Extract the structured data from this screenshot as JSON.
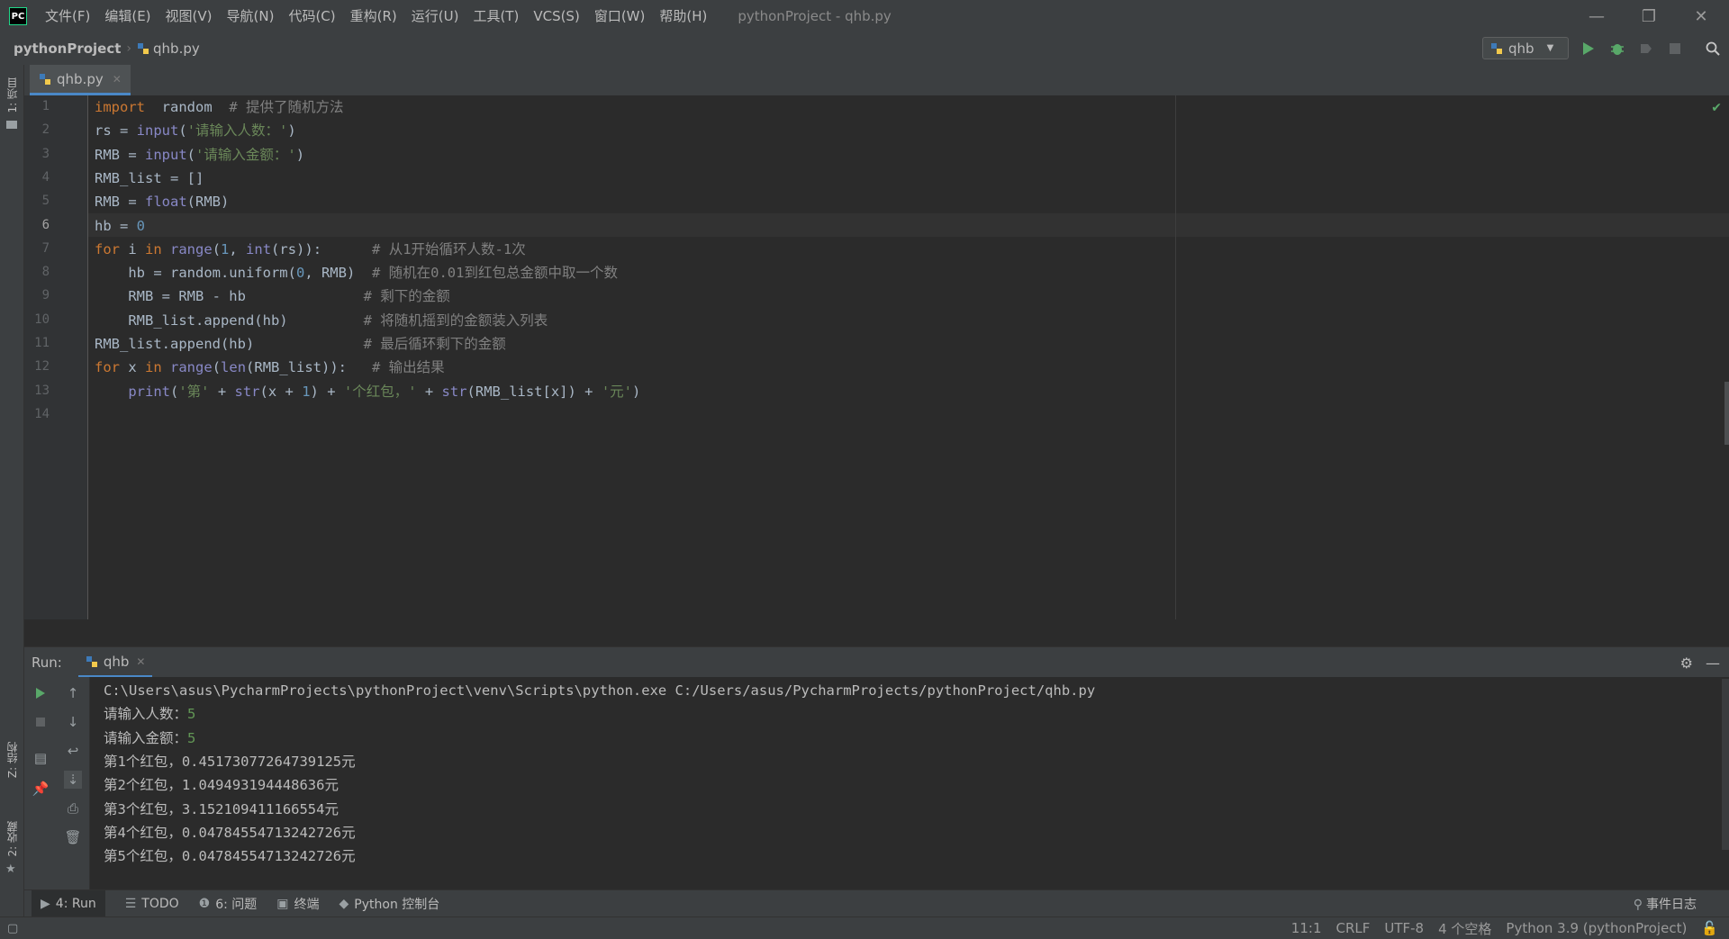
{
  "app": {
    "logo_text": "PC",
    "menu": [
      "文件(F)",
      "编辑(E)",
      "视图(V)",
      "导航(N)",
      "代码(C)",
      "重构(R)",
      "运行(U)",
      "工具(T)",
      "VCS(S)",
      "窗口(W)",
      "帮助(H)"
    ],
    "window_title": "pythonProject - qhb.py"
  },
  "navbar": {
    "project": "pythonProject",
    "file": "qhb.py",
    "run_config": "qhb"
  },
  "left_strip": {
    "project_label": "1: 项目",
    "structure_label": "Z: 结构",
    "favorites_label": "2: 收藏"
  },
  "editor": {
    "tab_label": "qhb.py",
    "current_line": 6,
    "line_numbers": [
      "1",
      "2",
      "3",
      "4",
      "5",
      "6",
      "7",
      "8",
      "9",
      "10",
      "11",
      "12",
      "13",
      "14"
    ],
    "lines": [
      {
        "seg": [
          [
            "kw",
            "import"
          ],
          [
            "",
            "  random  "
          ],
          [
            "cm",
            "# 提供了随机方法"
          ]
        ]
      },
      {
        "seg": [
          [
            "",
            "rs = "
          ],
          [
            "bi",
            "input"
          ],
          [
            "",
            "("
          ],
          [
            "str",
            "'请输入人数：'"
          ],
          [
            "",
            ")"
          ]
        ]
      },
      {
        "seg": [
          [
            "",
            "RMB = "
          ],
          [
            "bi",
            "input"
          ],
          [
            "",
            "("
          ],
          [
            "str",
            "'请输入金额：'"
          ],
          [
            "",
            ")"
          ]
        ]
      },
      {
        "seg": [
          [
            "",
            "RMB_list = []"
          ]
        ]
      },
      {
        "seg": [
          [
            "",
            "RMB = "
          ],
          [
            "bi",
            "float"
          ],
          [
            "",
            "(RMB)"
          ]
        ]
      },
      {
        "seg": [
          [
            "",
            "hb = "
          ],
          [
            "num",
            "0"
          ]
        ]
      },
      {
        "seg": [
          [
            "kw",
            "for"
          ],
          [
            "",
            " i "
          ],
          [
            "kw",
            "in"
          ],
          [
            "",
            " "
          ],
          [
            "bi",
            "range"
          ],
          [
            "",
            "("
          ],
          [
            "num",
            "1"
          ],
          [
            "",
            ", "
          ],
          [
            "bi",
            "int"
          ],
          [
            "",
            "(rs)):      "
          ],
          [
            "cm",
            "# 从1开始循环人数-1次"
          ]
        ]
      },
      {
        "seg": [
          [
            "",
            "    hb = random.uniform("
          ],
          [
            "num",
            "0"
          ],
          [
            "",
            ", RMB)  "
          ],
          [
            "cm",
            "# 随机在0.01到红包总金额中取一个数"
          ]
        ]
      },
      {
        "seg": [
          [
            "",
            "    RMB = RMB - hb              "
          ],
          [
            "cm",
            "# 剩下的金额"
          ]
        ]
      },
      {
        "seg": [
          [
            "",
            "    RMB_list.append(hb)         "
          ],
          [
            "cm",
            "# 将随机摇到的金额装入列表"
          ]
        ]
      },
      {
        "seg": [
          [
            "",
            "RMB_list.append(hb)             "
          ],
          [
            "cm",
            "# 最后循环剩下的金额"
          ]
        ]
      },
      {
        "seg": [
          [
            "kw",
            "for"
          ],
          [
            "",
            " x "
          ],
          [
            "kw",
            "in"
          ],
          [
            "",
            " "
          ],
          [
            "bi",
            "range"
          ],
          [
            "",
            "("
          ],
          [
            "bi",
            "len"
          ],
          [
            "",
            "(RMB_list)):   "
          ],
          [
            "cm",
            "# 输出结果"
          ]
        ]
      },
      {
        "seg": [
          [
            "",
            "    "
          ],
          [
            "bi",
            "print"
          ],
          [
            "",
            "("
          ],
          [
            "str",
            "'第'"
          ],
          [
            "",
            " + "
          ],
          [
            "bi",
            "str"
          ],
          [
            "",
            "(x + "
          ],
          [
            "num",
            "1"
          ],
          [
            "",
            ") + "
          ],
          [
            "str",
            "'个红包，'"
          ],
          [
            "",
            " + "
          ],
          [
            "bi",
            "str"
          ],
          [
            "",
            "(RMB_list[x]) + "
          ],
          [
            "str",
            "'元'"
          ],
          [
            "",
            ")"
          ]
        ]
      },
      {
        "seg": [
          [
            "",
            ""
          ]
        ]
      }
    ]
  },
  "run": {
    "label": "Run:",
    "tab": "qhb",
    "output": [
      {
        "text": "C:\\Users\\asus\\PycharmProjects\\pythonProject\\venv\\Scripts\\python.exe C:/Users/asus/PycharmProjects/pythonProject/qhb.py",
        "input": ""
      },
      {
        "text": "请输入人数：",
        "input": "5"
      },
      {
        "text": "请输入金额：",
        "input": "5"
      },
      {
        "text": "第1个红包，0.451730772647391​25元",
        "input": ""
      },
      {
        "text": "第2个红包，1.049493194448636元",
        "input": ""
      },
      {
        "text": "第3个红包，3.152109411166554元",
        "input": ""
      },
      {
        "text": "第4个红包，0.047845547132427​26元",
        "input": ""
      },
      {
        "text": "第5个红包，0.047845547132427​26元",
        "input": ""
      }
    ]
  },
  "bottom_tabs": [
    {
      "name": "run",
      "label": "4: Run",
      "icon": "▶"
    },
    {
      "name": "todo",
      "label": "TODO",
      "icon": "☰"
    },
    {
      "name": "problems",
      "label": "6: 问题",
      "icon": "❶"
    },
    {
      "name": "terminal",
      "label": "终端",
      "icon": "▣"
    },
    {
      "name": "python-console",
      "label": "Python 控制台",
      "icon": "◆"
    }
  ],
  "event_log": "事件日志",
  "status": {
    "position": "11:1",
    "line_sep": "CRLF",
    "encoding": "UTF-8",
    "indent": "4 个空格",
    "interpreter": "Python 3.9 (pythonProject)"
  },
  "colors": {
    "keyword": "#cc7832",
    "string": "#6a8759",
    "number": "#6897bb",
    "builtin": "#8888c6",
    "comment": "#808080",
    "run_green": "#59a869",
    "debug_green": "#59a869"
  }
}
